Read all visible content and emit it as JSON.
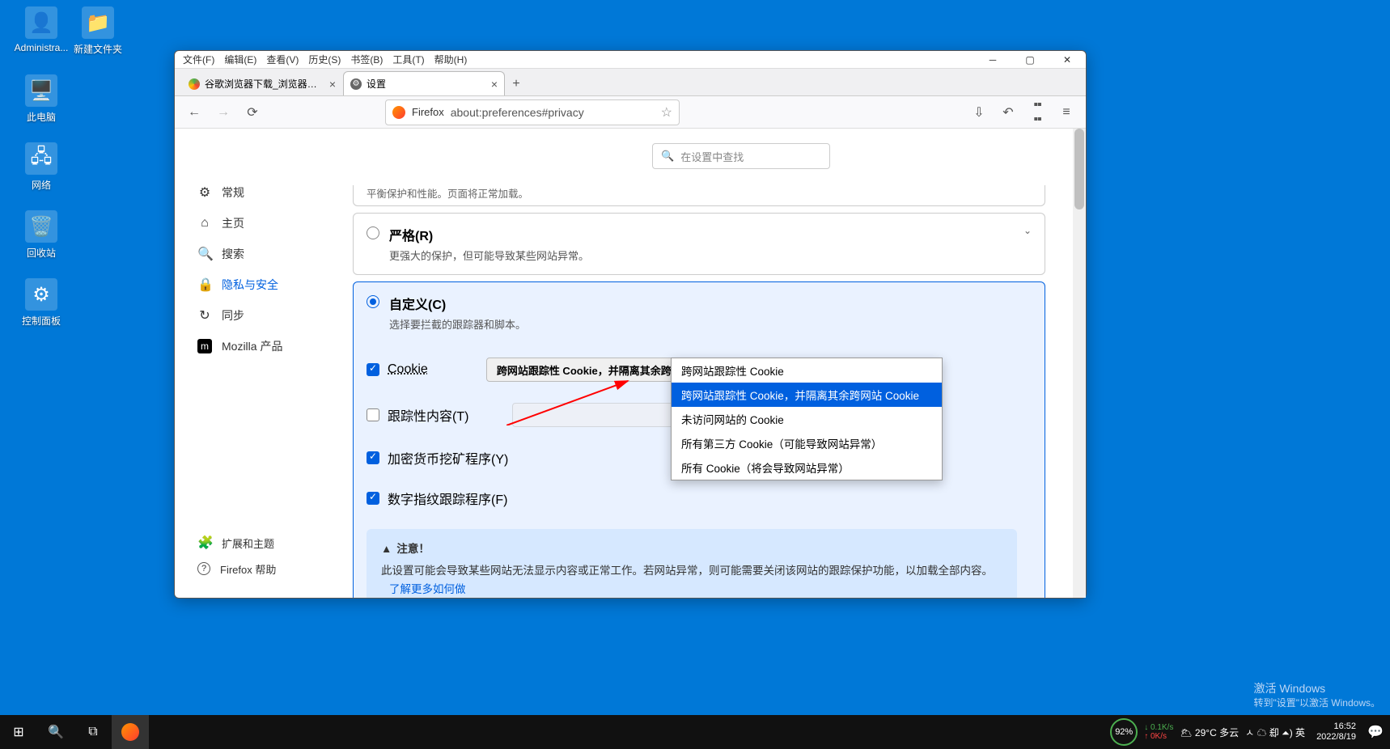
{
  "desktop": {
    "icons": [
      {
        "label": "Administra...",
        "glyph": "👤"
      },
      {
        "label": "新建文件夹",
        "glyph": "📁"
      },
      {
        "label": "此电脑",
        "glyph": "🖥️"
      },
      {
        "label": "网络",
        "glyph": "🖧"
      },
      {
        "label": "回收站",
        "glyph": "🗑️"
      },
      {
        "label": "控制面板",
        "glyph": "⚙"
      }
    ]
  },
  "window": {
    "menu": [
      "文件(F)",
      "编辑(E)",
      "查看(V)",
      "历史(S)",
      "书签(B)",
      "工具(T)",
      "帮助(H)"
    ],
    "tabs": [
      {
        "title": "谷歌浏览器下载_浏览器官网入...",
        "favicon": "#4caf50"
      },
      {
        "title": "设置",
        "favicon": "#888"
      }
    ],
    "url_brand": "Firefox",
    "url": "about:preferences#privacy",
    "search_placeholder": "在设置中查找"
  },
  "sidebar": {
    "items": [
      {
        "icon": "⚙",
        "label": "常规"
      },
      {
        "icon": "⌂",
        "label": "主页"
      },
      {
        "icon": "🔍",
        "label": "搜索"
      },
      {
        "icon": "🔒",
        "label": "隐私与安全",
        "active": true
      },
      {
        "icon": "↻",
        "label": "同步"
      },
      {
        "icon": "m",
        "label": "Mozilla 产品",
        "boxed": true
      }
    ],
    "footer": [
      {
        "icon": "🧩",
        "label": "扩展和主题"
      },
      {
        "icon": "?",
        "label": "Firefox 帮助"
      }
    ]
  },
  "settings": {
    "top_cut_text": "平衡保护和性能。页面将正常加载。",
    "strict": {
      "title": "严格(R)",
      "desc": "更强大的保护，但可能导致某些网站异常。"
    },
    "custom": {
      "title": "自定义(C)",
      "desc": "选择要拦截的跟踪器和脚本。"
    },
    "cookie": {
      "label": "Cookie",
      "selected": "跨网站跟踪性 Cookie，并隔离其余跨网站 Cookie"
    },
    "tracking": {
      "label": "跟踪性内容(T)"
    },
    "crypto": {
      "label": "加密货币挖矿程序(Y)"
    },
    "fingerprint": {
      "label": "数字指纹跟踪程序(F)"
    },
    "dropdown": [
      "跨网站跟踪性 Cookie",
      "跨网站跟踪性 Cookie，并隔离其余跨网站 Cookie",
      "未访问网站的 Cookie",
      "所有第三方 Cookie（可能导致网站异常）",
      "所有 Cookie（将会导致网站异常）"
    ],
    "alert": {
      "header": "注意！",
      "body": "此设置可能会导致某些网站无法显示内容或正常工作。若网站异常，则可能需要关闭该网站的跟踪保护功能，以加载全部内容。",
      "link": "了解更多如何做"
    }
  },
  "taskbar": {
    "battery": "92%",
    "net_down": "0.1K/s",
    "net_up": "0K/s",
    "weather": "29°C 多云",
    "tray": "ㅅ ☁ 㕁 ⏶) 英",
    "time": "16:52",
    "date": "2022/8/19"
  },
  "watermark": {
    "line1": "激活 Windows",
    "line2": "转到\"设置\"以激活 Windows。"
  }
}
